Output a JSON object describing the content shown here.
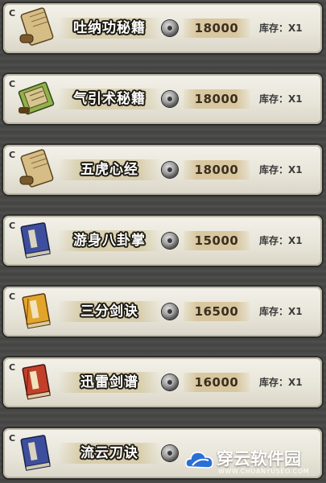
{
  "shop": {
    "items": [
      {
        "grade": "C",
        "icon": "scroll-icon",
        "name": "吐纳功秘籍",
        "price": "18000",
        "stock": "库存：X1"
      },
      {
        "grade": "C",
        "icon": "green-manual-icon",
        "name": "气引术秘籍",
        "price": "18000",
        "stock": "库存：X1"
      },
      {
        "grade": "C",
        "icon": "scroll-icon",
        "name": "五虎心经",
        "price": "18000",
        "stock": "库存：X1"
      },
      {
        "grade": "C",
        "icon": "blue-book-icon",
        "name": "游身八卦掌",
        "price": "15000",
        "stock": "库存：X1"
      },
      {
        "grade": "C",
        "icon": "yellow-book-icon",
        "name": "三分剑诀",
        "price": "16500",
        "stock": "库存：X1"
      },
      {
        "grade": "C",
        "icon": "red-book-icon",
        "name": "迅雷剑谱",
        "price": "16000",
        "stock": "库存：X1"
      },
      {
        "grade": "C",
        "icon": "blue-book-icon",
        "name": "流云刀诀",
        "price": "",
        "stock": ""
      }
    ],
    "currency_icon": "silver-coin-icon"
  },
  "watermark": {
    "title": "穿云软件园",
    "url": "WWW.CHUANYUSEO.COM",
    "logo_icon": "cloud-logo-icon"
  },
  "colors": {
    "background": "#4a4a48",
    "row": "#ebe8dc",
    "name_outline": "#1d1a12",
    "price_band": "#d9c7a0"
  }
}
